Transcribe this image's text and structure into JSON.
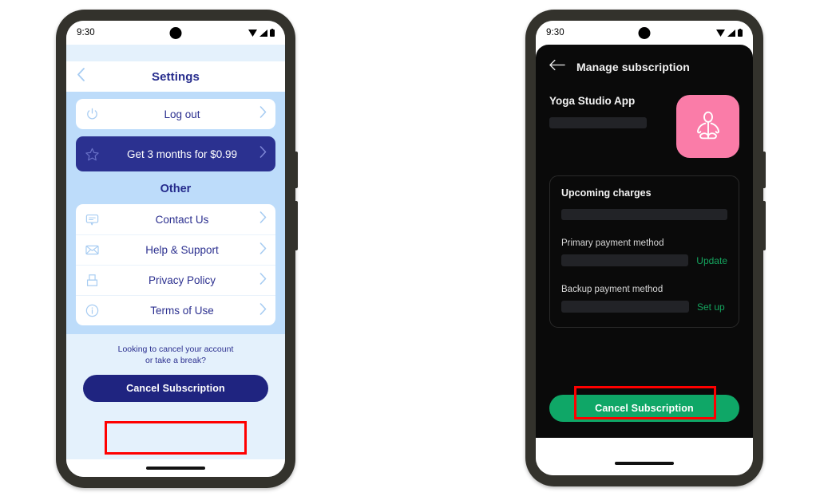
{
  "left_phone": {
    "status_bar": {
      "time": "9:30",
      "icons": [
        "wifi-icon",
        "signal-icon",
        "battery-icon"
      ]
    },
    "header": {
      "back_icon": "chevron-left-icon",
      "title": "Settings"
    },
    "primary_list": [
      {
        "icon": "power-icon",
        "label": "Log out",
        "chevron": "chevron-right-icon"
      }
    ],
    "promo": {
      "icon": "star-icon",
      "label": "Get 3 months for $0.99",
      "chevron": "chevron-right-icon"
    },
    "section_heading": "Other",
    "other_list": [
      {
        "icon": "chat-bubble-icon",
        "label": "Contact Us",
        "chevron": "chevron-right-icon"
      },
      {
        "icon": "envelope-icon",
        "label": "Help & Support",
        "chevron": "chevron-right-icon"
      },
      {
        "icon": "lock-icon",
        "label": "Privacy Policy",
        "chevron": "chevron-right-icon"
      },
      {
        "icon": "info-circle-icon",
        "label": "Terms of Use",
        "chevron": "chevron-right-icon"
      }
    ],
    "footer": {
      "note_line1": "Looking to cancel your account",
      "note_line2": "or take a break?",
      "cta_label": "Cancel Subscription"
    }
  },
  "right_phone": {
    "status_bar": {
      "time": "9:30",
      "icons": [
        "wifi-icon",
        "signal-icon",
        "battery-icon"
      ]
    },
    "header": {
      "back_icon": "arrow-left-icon",
      "title": "Manage subscription"
    },
    "app": {
      "name": "Yoga Studio App",
      "detail_redacted": "",
      "tile_icon": "yoga-pose-icon"
    },
    "panel": {
      "title": "Upcoming charges",
      "charges_redacted": "",
      "fields": [
        {
          "label": "Primary payment method",
          "value_redacted": "",
          "action": "Update"
        },
        {
          "label": "Backup payment method",
          "value_redacted": "",
          "action": "Set up"
        }
      ]
    },
    "cta_label": "Cancel Subscription"
  },
  "colors": {
    "brand_blue": "#2B3190",
    "deep_blue": "#1F2480",
    "light_blue": "#BDDCFA",
    "pale_blue": "#E4F1FC",
    "green": "#0FA767",
    "link_green": "#15A45E",
    "pink": "#FA7CA8",
    "dark_bg": "#0A0A0A",
    "highlight_red": "#FF0000"
  }
}
